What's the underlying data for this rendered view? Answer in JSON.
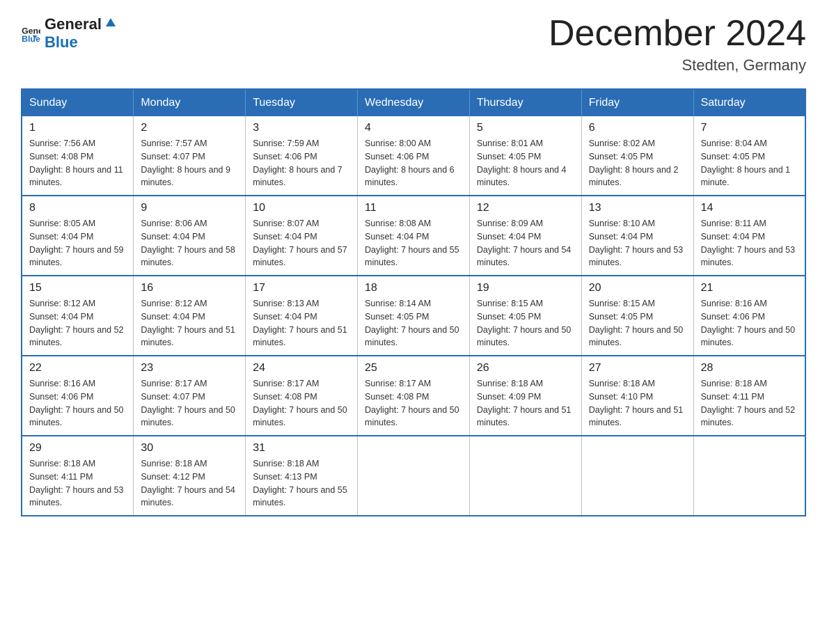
{
  "header": {
    "logo_general": "General",
    "logo_blue": "Blue",
    "title": "December 2024",
    "subtitle": "Stedten, Germany"
  },
  "weekdays": [
    "Sunday",
    "Monday",
    "Tuesday",
    "Wednesday",
    "Thursday",
    "Friday",
    "Saturday"
  ],
  "weeks": [
    [
      {
        "day": "1",
        "sunrise": "7:56 AM",
        "sunset": "4:08 PM",
        "daylight": "8 hours and 11 minutes."
      },
      {
        "day": "2",
        "sunrise": "7:57 AM",
        "sunset": "4:07 PM",
        "daylight": "8 hours and 9 minutes."
      },
      {
        "day": "3",
        "sunrise": "7:59 AM",
        "sunset": "4:06 PM",
        "daylight": "8 hours and 7 minutes."
      },
      {
        "day": "4",
        "sunrise": "8:00 AM",
        "sunset": "4:06 PM",
        "daylight": "8 hours and 6 minutes."
      },
      {
        "day": "5",
        "sunrise": "8:01 AM",
        "sunset": "4:05 PM",
        "daylight": "8 hours and 4 minutes."
      },
      {
        "day": "6",
        "sunrise": "8:02 AM",
        "sunset": "4:05 PM",
        "daylight": "8 hours and 2 minutes."
      },
      {
        "day": "7",
        "sunrise": "8:04 AM",
        "sunset": "4:05 PM",
        "daylight": "8 hours and 1 minute."
      }
    ],
    [
      {
        "day": "8",
        "sunrise": "8:05 AM",
        "sunset": "4:04 PM",
        "daylight": "7 hours and 59 minutes."
      },
      {
        "day": "9",
        "sunrise": "8:06 AM",
        "sunset": "4:04 PM",
        "daylight": "7 hours and 58 minutes."
      },
      {
        "day": "10",
        "sunrise": "8:07 AM",
        "sunset": "4:04 PM",
        "daylight": "7 hours and 57 minutes."
      },
      {
        "day": "11",
        "sunrise": "8:08 AM",
        "sunset": "4:04 PM",
        "daylight": "7 hours and 55 minutes."
      },
      {
        "day": "12",
        "sunrise": "8:09 AM",
        "sunset": "4:04 PM",
        "daylight": "7 hours and 54 minutes."
      },
      {
        "day": "13",
        "sunrise": "8:10 AM",
        "sunset": "4:04 PM",
        "daylight": "7 hours and 53 minutes."
      },
      {
        "day": "14",
        "sunrise": "8:11 AM",
        "sunset": "4:04 PM",
        "daylight": "7 hours and 53 minutes."
      }
    ],
    [
      {
        "day": "15",
        "sunrise": "8:12 AM",
        "sunset": "4:04 PM",
        "daylight": "7 hours and 52 minutes."
      },
      {
        "day": "16",
        "sunrise": "8:12 AM",
        "sunset": "4:04 PM",
        "daylight": "7 hours and 51 minutes."
      },
      {
        "day": "17",
        "sunrise": "8:13 AM",
        "sunset": "4:04 PM",
        "daylight": "7 hours and 51 minutes."
      },
      {
        "day": "18",
        "sunrise": "8:14 AM",
        "sunset": "4:05 PM",
        "daylight": "7 hours and 50 minutes."
      },
      {
        "day": "19",
        "sunrise": "8:15 AM",
        "sunset": "4:05 PM",
        "daylight": "7 hours and 50 minutes."
      },
      {
        "day": "20",
        "sunrise": "8:15 AM",
        "sunset": "4:05 PM",
        "daylight": "7 hours and 50 minutes."
      },
      {
        "day": "21",
        "sunrise": "8:16 AM",
        "sunset": "4:06 PM",
        "daylight": "7 hours and 50 minutes."
      }
    ],
    [
      {
        "day": "22",
        "sunrise": "8:16 AM",
        "sunset": "4:06 PM",
        "daylight": "7 hours and 50 minutes."
      },
      {
        "day": "23",
        "sunrise": "8:17 AM",
        "sunset": "4:07 PM",
        "daylight": "7 hours and 50 minutes."
      },
      {
        "day": "24",
        "sunrise": "8:17 AM",
        "sunset": "4:08 PM",
        "daylight": "7 hours and 50 minutes."
      },
      {
        "day": "25",
        "sunrise": "8:17 AM",
        "sunset": "4:08 PM",
        "daylight": "7 hours and 50 minutes."
      },
      {
        "day": "26",
        "sunrise": "8:18 AM",
        "sunset": "4:09 PM",
        "daylight": "7 hours and 51 minutes."
      },
      {
        "day": "27",
        "sunrise": "8:18 AM",
        "sunset": "4:10 PM",
        "daylight": "7 hours and 51 minutes."
      },
      {
        "day": "28",
        "sunrise": "8:18 AM",
        "sunset": "4:11 PM",
        "daylight": "7 hours and 52 minutes."
      }
    ],
    [
      {
        "day": "29",
        "sunrise": "8:18 AM",
        "sunset": "4:11 PM",
        "daylight": "7 hours and 53 minutes."
      },
      {
        "day": "30",
        "sunrise": "8:18 AM",
        "sunset": "4:12 PM",
        "daylight": "7 hours and 54 minutes."
      },
      {
        "day": "31",
        "sunrise": "8:18 AM",
        "sunset": "4:13 PM",
        "daylight": "7 hours and 55 minutes."
      },
      null,
      null,
      null,
      null
    ]
  ]
}
